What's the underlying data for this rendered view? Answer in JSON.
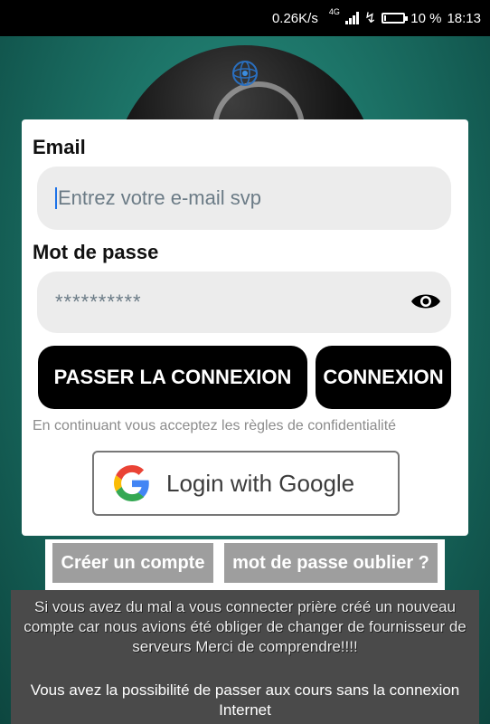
{
  "status_bar": {
    "network_speed": "0.26K/s",
    "network_type": "4G",
    "battery_percent": "10 %",
    "battery_level": 0.1,
    "time": "18:13"
  },
  "login_form": {
    "email_label": "Email",
    "email_placeholder": "Entrez votre e-mail svp",
    "email_value": "",
    "password_label": "Mot de passe",
    "password_value": "**********",
    "skip_button_label": "PASSER LA CONNEXION",
    "login_button_label": "CONNEXION",
    "terms_text": "En continuant vous acceptez les règles de confidentialité",
    "google_button_label": "Login with Google"
  },
  "secondary_actions": {
    "create_account_label": "Créer un compte",
    "forgot_password_label": "mot de passe oublier ?"
  },
  "notice": {
    "paragraph_1": "Si vous avez du mal a vous connecter prière créé un nouveau compte car nous avions été obliger de changer de fournisseur de serveurs Merci de comprendre!!!!",
    "paragraph_2": "Vous avez la possibilité de passer aux cours sans la connexion Internet"
  },
  "colors": {
    "primary_button": "#000000",
    "secondary_button": "#9e9e9e",
    "field_background": "#ececec",
    "notice_background": "#4a4a4a",
    "background_teal": "#1f7a6d"
  },
  "icons": [
    "signal-icon",
    "charging-icon",
    "battery-icon",
    "eye-icon",
    "google-icon",
    "app-logo-icon"
  ]
}
